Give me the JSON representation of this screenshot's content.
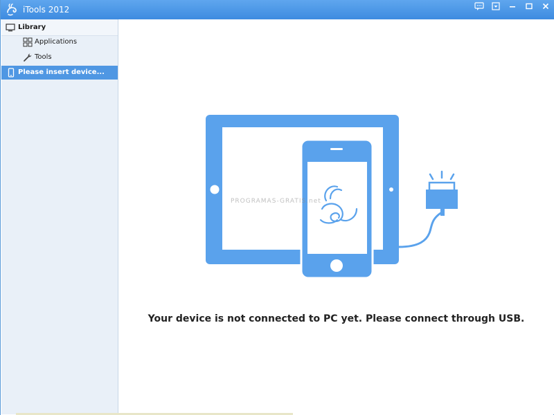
{
  "window": {
    "title": "iTools 2012"
  },
  "sidebar": {
    "library_label": "Library",
    "items": [
      {
        "label": "Applications",
        "icon": "grid-icon"
      },
      {
        "label": "Tools",
        "icon": "wrench-icon"
      }
    ],
    "device_label": "Please insert device..."
  },
  "main": {
    "message": "Your device is not connected to PC yet. Please connect through USB."
  },
  "watermark": "PROGRAMAS-GRATIS.net",
  "colors": {
    "accent": "#4f97e3",
    "illustration": "#5aa2ec",
    "sidebar_bg": "#e9f0f8"
  }
}
